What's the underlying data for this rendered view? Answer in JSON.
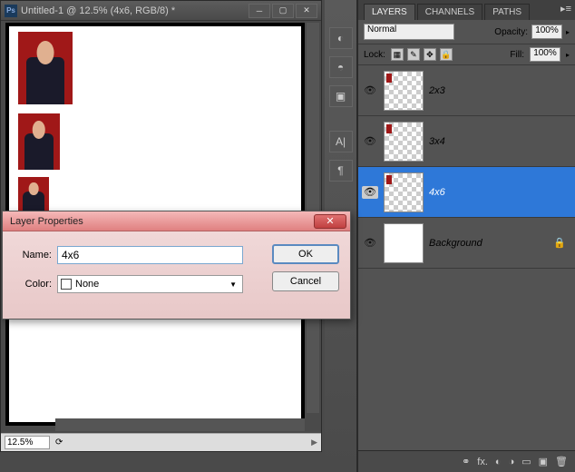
{
  "document": {
    "title": "Untitled-1 @ 12.5% (4x6, RGB/8) *",
    "zoom": "12.5%"
  },
  "dialog": {
    "title": "Layer Properties",
    "name_label": "Name:",
    "name_value": "4x6",
    "color_label": "Color:",
    "color_value": "None",
    "ok": "OK",
    "cancel": "Cancel"
  },
  "panel": {
    "tabs": [
      "LAYERS",
      "CHANNELS",
      "PATHS"
    ],
    "blend_mode": "Normal",
    "opacity_label": "Opacity:",
    "opacity_value": "100%",
    "lock_label": "Lock:",
    "fill_label": "Fill:",
    "fill_value": "100%",
    "layers": [
      {
        "name": "2x3",
        "selected": false,
        "bg": false
      },
      {
        "name": "3x4",
        "selected": false,
        "bg": false
      },
      {
        "name": "4x6",
        "selected": true,
        "bg": false
      },
      {
        "name": "Background",
        "selected": false,
        "bg": true
      }
    ]
  }
}
